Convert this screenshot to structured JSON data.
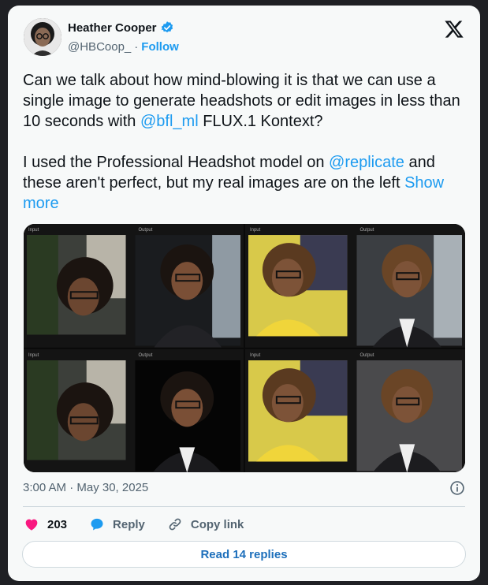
{
  "author": {
    "name": "Heather Cooper",
    "handle": "@HBCoop_",
    "separator": "·",
    "follow_label": "Follow"
  },
  "tweet": {
    "p1_before": "Can we talk about how mind-blowing it is that we can use a single image to generate headshots or edit images in less than 10 seconds with ",
    "p1_mention": "@bfl_ml",
    "p1_after": " FLUX.1 Kontext?",
    "p2_before": "I used the Professional Headshot model on ",
    "p2_mention": "@replicate",
    "p2_after": " and these aren't perfect, but my real images are on the left ",
    "show_more": "Show more"
  },
  "media": {
    "panels": [
      {
        "input_label": "Input",
        "output_label": "Output"
      },
      {
        "input_label": "Input",
        "output_label": "Output"
      },
      {
        "input_label": "Input",
        "output_label": "Output"
      },
      {
        "input_label": "Input",
        "output_label": "Output"
      }
    ]
  },
  "timestamp": "3:00 AM · May 30, 2025",
  "actions": {
    "likes": "203",
    "reply_label": "Reply",
    "copy_link_label": "Copy link"
  },
  "read_replies_label": "Read 14 replies",
  "colors": {
    "accent": "#1d9bf0",
    "like": "#f91880",
    "text": "#0f1419",
    "muted": "#536471"
  }
}
